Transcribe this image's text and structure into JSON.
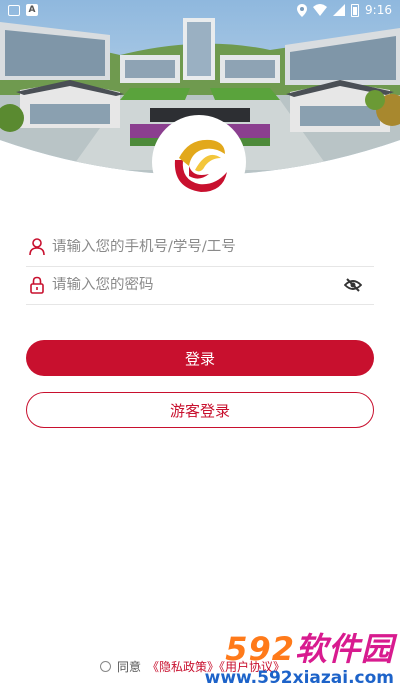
{
  "status_bar": {
    "time": "9:16"
  },
  "form": {
    "account_placeholder": "请输入您的手机号/学号/工号",
    "password_placeholder": "请输入您的密码"
  },
  "buttons": {
    "login": "登录",
    "guest_login": "游客登录"
  },
  "agreement": {
    "prefix": "同意",
    "policy_link": "《隐私政策》《用户协议》"
  },
  "watermark": {
    "brand_number": "592",
    "brand_text": "软件园",
    "url": "www.592xiazai.com"
  },
  "colors": {
    "accent": "#c8102e"
  }
}
